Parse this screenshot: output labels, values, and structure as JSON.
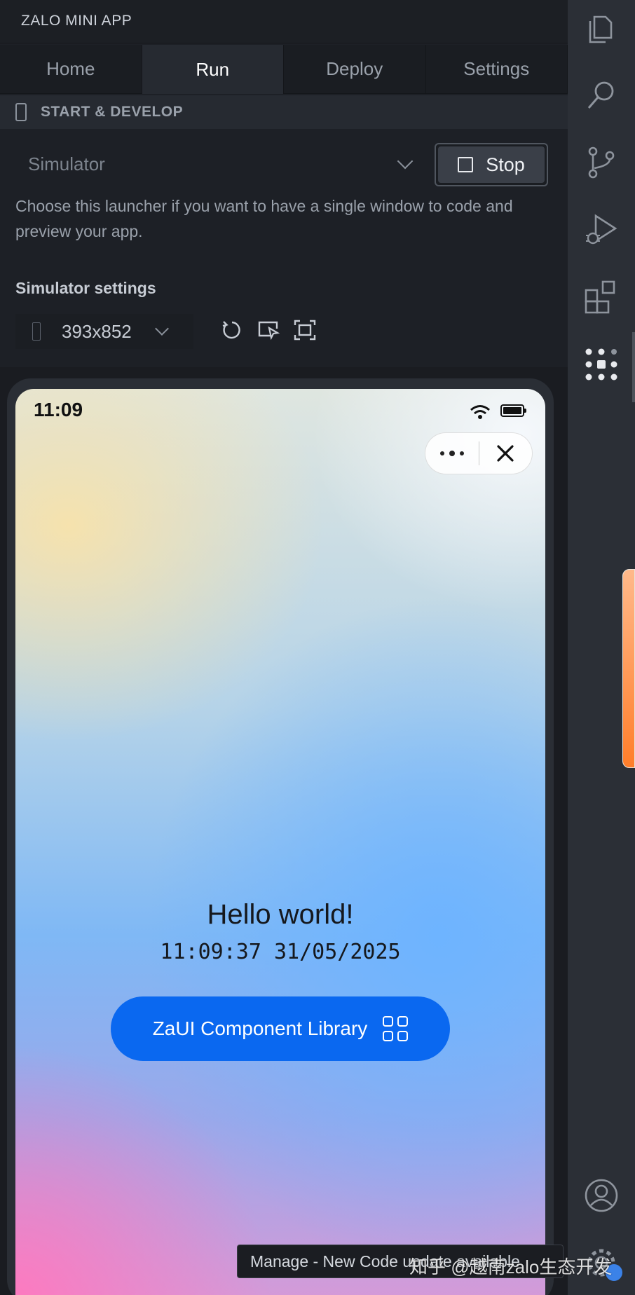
{
  "panel": {
    "title": "ZALO MINI APP",
    "tabs": [
      {
        "label": "Home"
      },
      {
        "label": "Run"
      },
      {
        "label": "Deploy"
      },
      {
        "label": "Settings"
      }
    ],
    "active_tab": "Run",
    "section": {
      "title": "START & DEVELOP",
      "icon": "phone-icon"
    },
    "launcher": {
      "selected": "Simulator",
      "stop_label": "Stop",
      "description": "Choose this launcher if you want to have a single window to code and preview your app."
    },
    "simulator_settings": {
      "title": "Simulator settings",
      "device_size": "393x852",
      "tools": [
        "refresh-icon",
        "inspect-icon",
        "screenshot-icon"
      ]
    }
  },
  "phone": {
    "status_time": "11:09",
    "greeting": "Hello world!",
    "clock": "11:09:37 31/05/2025",
    "button_label": "ZaUI Component Library"
  },
  "toast": {
    "text": "Manage - New Code update available"
  },
  "watermark": "知乎 @越南zalo生态开发",
  "activity_bar": {
    "icons": [
      "files-icon",
      "search-icon",
      "source-control-icon",
      "run-debug-icon",
      "extensions-icon",
      "zalo-mini-app-icon",
      "account-icon",
      "manage-gear-icon"
    ]
  },
  "colors": {
    "accent": "#0a68f0",
    "panel_bg": "#1d2026",
    "activity_bg": "#2b2f36"
  }
}
